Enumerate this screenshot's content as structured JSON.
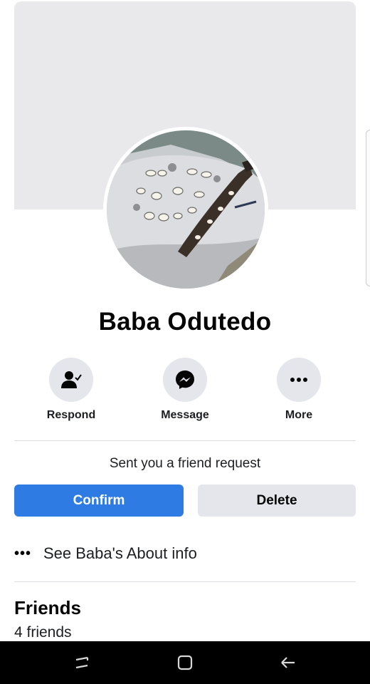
{
  "profile": {
    "name": "Baba Odutedo"
  },
  "actions": [
    {
      "label": "Respond",
      "icon": "person-check-icon"
    },
    {
      "label": "Message",
      "icon": "messenger-icon"
    },
    {
      "label": "More",
      "icon": "more-dots-icon"
    }
  ],
  "friend_request": {
    "status_text": "Sent you a friend request",
    "confirm_label": "Confirm",
    "delete_label": "Delete"
  },
  "about": {
    "dots": "•••",
    "label": "See Baba's About info"
  },
  "friends": {
    "title": "Friends",
    "count_text": "4 friends"
  },
  "colors": {
    "accent": "#2e7be3",
    "secondary_button": "#e4e6eb",
    "cover": "#e9e9ec"
  },
  "system_nav": {
    "buttons": [
      "recent-apps-icon",
      "home-icon",
      "back-icon"
    ]
  }
}
